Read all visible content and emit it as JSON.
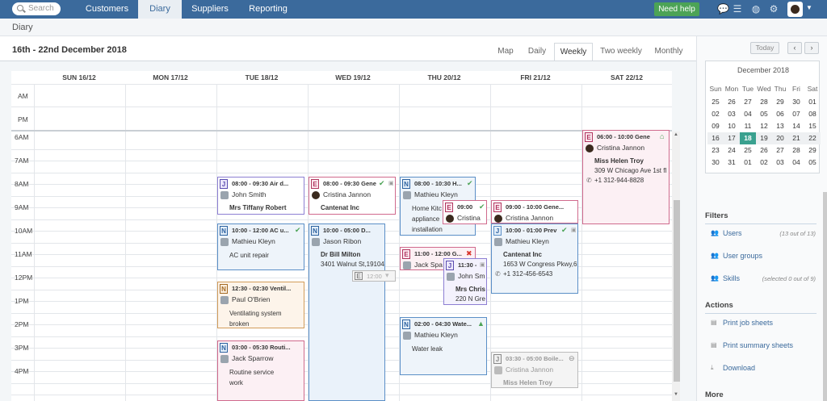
{
  "nav": {
    "search_placeholder": "Search",
    "tabs": [
      {
        "label": "Customers"
      },
      {
        "label": "Diary"
      },
      {
        "label": "Suppliers"
      },
      {
        "label": "Reporting"
      }
    ],
    "need_help": "Need help"
  },
  "page": {
    "title": "Diary",
    "date_range": "16th - 22nd December 2018"
  },
  "view_tabs": [
    "Map",
    "Daily",
    "Weekly",
    "Two weekly",
    "Monthly"
  ],
  "days": [
    "SUN 16/12",
    "MON 17/12",
    "TUE 18/12",
    "WED 19/12",
    "THU 20/12",
    "FRI 21/12",
    "SAT 22/12"
  ],
  "rows": {
    "am": "AM",
    "pm": "PM",
    "hours": [
      "6AM",
      "7AM",
      "8AM",
      "9AM",
      "10AM",
      "11AM",
      "12PM",
      "1PM",
      "2PM",
      "3PM",
      "4PM"
    ]
  },
  "events": [
    {
      "badge": "J",
      "time": "08:00 - 09:30  Air d...",
      "person": "John Smith",
      "lines": [
        "Mrs Tiffany Robert"
      ]
    },
    {
      "badge": "N",
      "time": "10:00 - 12:00  AC u...",
      "person": "Mathieu Kleyn",
      "lines": [
        "AC unit repair"
      ]
    },
    {
      "badge": "N",
      "time": "12:30 - 02:30  Ventil...",
      "person": "Paul O'Brien",
      "lines": [
        "Ventilating system",
        "broken"
      ]
    },
    {
      "badge": "N",
      "time": "03:00 - 05:30  Routi...",
      "person": "Jack Sparrow",
      "lines": [
        "Routine service",
        "work"
      ]
    },
    {
      "badge": "E",
      "time": "08:00 - 09:30  Gene",
      "person": "Cristina Jannon",
      "lines": [
        "Cantenat Inc"
      ]
    },
    {
      "badge": "N",
      "time": "10:00 - 05:00  D...",
      "person": "Jason Ribon",
      "lines": [
        "Dr Bill Milton",
        "3401 Walnut St,19104"
      ]
    },
    {
      "badge": "E",
      "time": "12:00"
    },
    {
      "badge": "N",
      "time": "08:00 - 10:30  H...",
      "person": "Mathieu Kleyn",
      "lines": [
        "Home Kitc",
        "appliance",
        "installation"
      ]
    },
    {
      "badge": "E",
      "time": "09:00",
      "person": "Cristina"
    },
    {
      "badge": "E",
      "time": "11:00 - 12:00  G...",
      "person": "Jack Spa"
    },
    {
      "badge": "J",
      "time": "11:30 -",
      "person": "John Sm",
      "lines": [
        "Mrs Chris",
        "220 N Gre"
      ]
    },
    {
      "badge": "N",
      "time": "02:00 - 04:30  Wate...",
      "person": "Mathieu Kleyn",
      "lines": [
        "Water leak"
      ]
    },
    {
      "badge": "E",
      "time": "09:00 - 10:00  Gene...",
      "person": "Cristina Jannon"
    },
    {
      "badge": "J",
      "time": "10:00 - 01:00  Prev",
      "person": "Mathieu Kleyn",
      "lines": [
        "Cantenat Inc",
        "1653 W Congress Pkwy,6",
        "+1 312-456-6543"
      ]
    },
    {
      "badge": "J",
      "time": "03:30 - 05:00  Boile...",
      "person": "Cristina Jannon",
      "lines": [
        "Miss Helen Troy"
      ]
    },
    {
      "badge": "E",
      "time": "06:00 - 10:00  Gene",
      "person": "Cristina Jannon",
      "lines": [
        "Miss Helen Troy",
        "309 W Chicago Ave 1st fl",
        "+1 312-944-8828"
      ]
    }
  ],
  "sidebar": {
    "today": "Today",
    "prev": "‹",
    "next": "›",
    "month": "December 2018",
    "dow": [
      "Sun",
      "Mon",
      "Tue",
      "Wed",
      "Thu",
      "Fri",
      "Sat"
    ],
    "weeks": [
      [
        "25",
        "26",
        "27",
        "28",
        "29",
        "30",
        "01"
      ],
      [
        "02",
        "03",
        "04",
        "05",
        "06",
        "07",
        "08"
      ],
      [
        "09",
        "10",
        "11",
        "12",
        "13",
        "14",
        "15"
      ],
      [
        "16",
        "17",
        "18",
        "19",
        "20",
        "21",
        "22"
      ],
      [
        "23",
        "24",
        "25",
        "26",
        "27",
        "28",
        "29"
      ],
      [
        "30",
        "31",
        "01",
        "02",
        "03",
        "04",
        "05"
      ]
    ],
    "filters_title": "Filters",
    "filters": [
      {
        "label": "Users",
        "note": "(13 out of 13)"
      },
      {
        "label": "User groups",
        "note": ""
      },
      {
        "label": "Skills",
        "note": "(selected 0 out of 9)"
      }
    ],
    "actions_title": "Actions",
    "actions": [
      {
        "label": "Print job sheets"
      },
      {
        "label": "Print summary sheets"
      },
      {
        "label": "Download"
      }
    ],
    "more_title": "More"
  }
}
